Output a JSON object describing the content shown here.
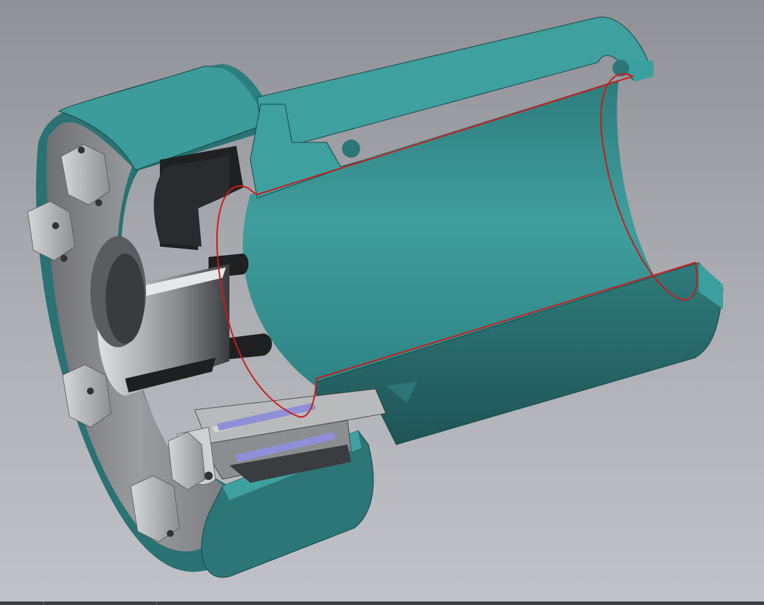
{
  "viewport": {
    "background_top": "#8f9196",
    "background_bottom": "#c0c2c7",
    "model": {
      "description_icon": "cad-section-model-icon",
      "colors": {
        "housing_face": "#3d9e9d",
        "housing_dark": "#2a6f70",
        "housing_inner": "#348b8a",
        "steel_gray": "#8b8d90",
        "steel_light": "#c9cacc",
        "steel_dark": "#2c2d30",
        "bearing_blue": "#8f8fd8",
        "section_outline": "#cc1a1a"
      }
    }
  },
  "statusbar": {
    "color": "#3b3d42"
  }
}
